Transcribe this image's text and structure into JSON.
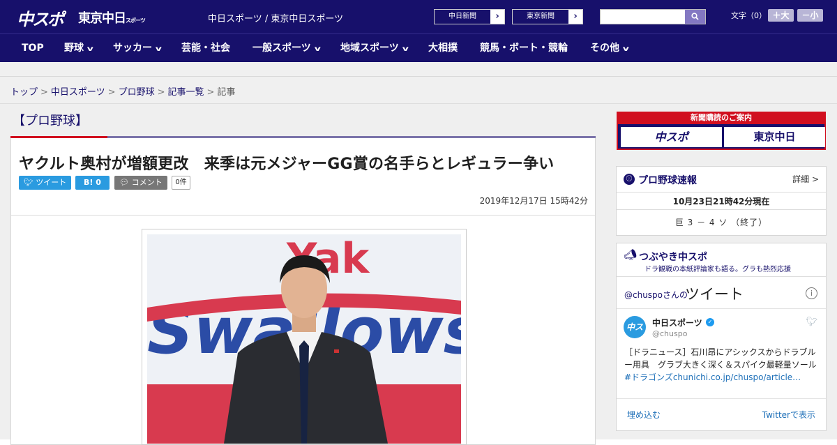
{
  "header": {
    "logo_main": "中スポ",
    "logo_tokyo": "東京中日",
    "logo_tokyo_small": "スポーツ",
    "site_title": "中日スポーツ / 東京中日スポーツ",
    "paper_buttons": [
      {
        "label": "中日新聞",
        "arrow": "›"
      },
      {
        "label": "東京新聞",
        "arrow": "›"
      }
    ],
    "search_placeholder": "",
    "search_icon": "search-icon",
    "font_size_label": "文字（0）",
    "font_larger": "＋大",
    "font_smaller": "－小"
  },
  "nav": {
    "items": [
      {
        "label": "TOP",
        "dropdown": false
      },
      {
        "label": "野球",
        "dropdown": true
      },
      {
        "label": "サッカー",
        "dropdown": true
      },
      {
        "label": "芸能・社会",
        "dropdown": false
      },
      {
        "label": "一般スポーツ",
        "dropdown": true
      },
      {
        "label": "地域スポーツ",
        "dropdown": true
      },
      {
        "label": "大相撲",
        "dropdown": false
      },
      {
        "label": "競馬・ボート・競輪",
        "dropdown": false
      },
      {
        "label": "その他",
        "dropdown": true
      }
    ]
  },
  "breadcrumb": [
    "トップ",
    "中日スポーツ",
    "プロ野球",
    "記事一覧",
    "記事"
  ],
  "article": {
    "category": "【プロ野球】",
    "headline": "ヤクルト奥村が増額更改　来季は元メジャーGG賞の名手らとレギュラー争い",
    "tweet_label": "ツイート",
    "hatena_label": "B!",
    "hatena_count": "0",
    "comment_label": "コメント",
    "comment_count": "0件",
    "date": "2019年12月17日 15時42分",
    "photo_backdrop_text": "Yakult Swallows"
  },
  "sidebar": {
    "subscribe_title": "新聞購読のご案内",
    "subscribe_left": "中スポ",
    "subscribe_right": "東京中日",
    "score": {
      "title": "プロ野球速報",
      "detail": "詳細 >",
      "time": "10月23日21時42分現在",
      "game": "巨 3 － 4 ソ （終了）"
    },
    "tweets": {
      "title": "つぶやき中スポ",
      "subtitle": "ドラ観戦の本紙評論家も語る。グラも熱烈応援",
      "handle": "@chuspoさんの",
      "label": "ツイート",
      "account_name": "中日スポーツ",
      "account_handle": "@chuspo",
      "tweet_text": "［ドラニュース］石川昂にアシックスからドラブルー用具　グラブ大きく深く＆スパイク最軽量ソール",
      "tweet_link": "#ドラゴンズchunichi.co.jp/chuspo/article…",
      "embed": "埋め込む",
      "view": "Twitterで表示"
    }
  },
  "colors": {
    "brand_navy": "#17106b",
    "accent_red": "#d10f1f",
    "twitter_blue": "#2a9be0"
  }
}
